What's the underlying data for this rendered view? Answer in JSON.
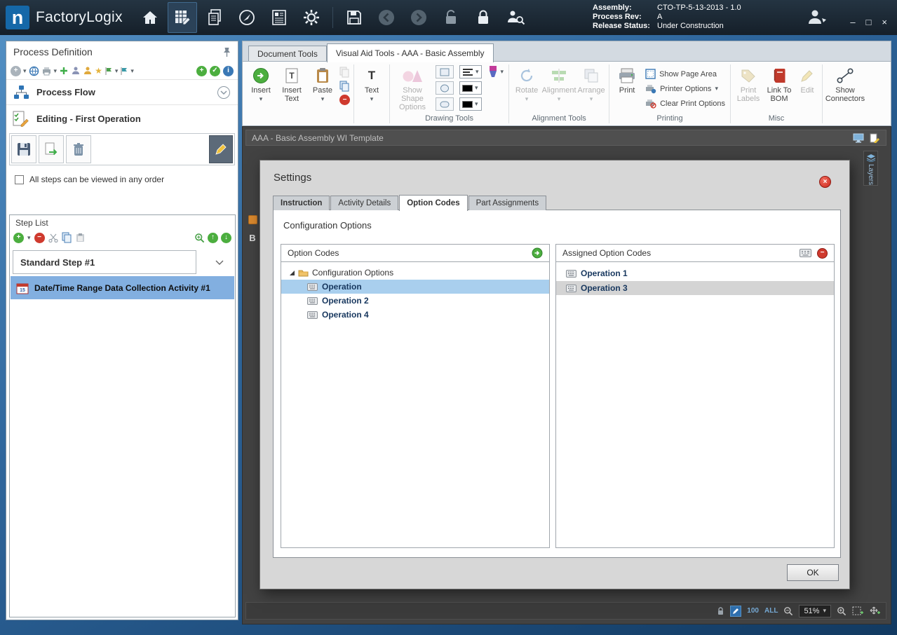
{
  "icons": {
    "dropdown": "▾",
    "plus": "+",
    "minus": "−",
    "check": "✓",
    "info": "i",
    "up_arrow": "↑",
    "down_arrow": "↓",
    "star": "★",
    "minimize": "–",
    "maximize": "□",
    "close": "×",
    "bold": "B",
    "text_tool": "T"
  },
  "colors": {
    "titlebar_bg": "#1a2732",
    "accent_blue": "#2f6fae",
    "tree_selection": "#a9cfee",
    "step_selection": "#82afe0",
    "doc_area_bg": "#424242",
    "dialog_bg": "#d7d7d7",
    "close_red": "#cd2a1e",
    "add_green": "#4cae3f",
    "remove_red": "#cf3a2e"
  },
  "titlebar": {
    "app_name": "FactoryLogix",
    "assembly_label": "Assembly:",
    "assembly_value": "CTO-TP-5-13-2013 - 1.0",
    "process_rev_label": "Process Rev:",
    "process_rev_value": "A",
    "release_status_label": "Release Status:",
    "release_status_value": "Under Construction"
  },
  "left_panel": {
    "title": "Process Definition",
    "process_flow_label": "Process Flow",
    "editing_label": "Editing - First Operation",
    "order_checkbox_label": "All steps can be viewed in any order",
    "step_list": {
      "title": "Step List",
      "group_header": "Standard Step #1",
      "selected_activity": "Date/Time Range Data Collection Activity #1"
    }
  },
  "main": {
    "doc_tabs": [
      {
        "label": "Document Tools"
      },
      {
        "label": "Visual Aid Tools - AAA - Basic Assembly"
      }
    ],
    "ribbon": {
      "insert": "Insert",
      "insert_text": "Insert Text",
      "paste": "Paste",
      "text": "Text",
      "show_shape_options": "Show Shape Options",
      "drawing_tools_group": "Drawing Tools",
      "rotate": "Rotate",
      "alignment": "Alignment",
      "arrange": "Arrange",
      "alignment_tools_group": "Alignment Tools",
      "print": "Print",
      "show_page_area": "Show Page Area",
      "printer_options": "Printer Options",
      "clear_print_options": "Clear Print Options",
      "printing_group": "Printing",
      "print_labels": "Print Labels",
      "link_to_bom": "Link To BOM",
      "edit": "Edit",
      "misc_group": "Misc",
      "show_connectors": "Show Connectors"
    },
    "document_title": "AAA - Basic Assembly WI Template",
    "layers_tab": "Layers",
    "statusbar": {
      "preset_100": "100",
      "preset_all": "ALL",
      "zoom": "51%"
    }
  },
  "dialog": {
    "title": "Settings",
    "tabs": [
      {
        "label": "Instruction"
      },
      {
        "label": "Activity Details"
      },
      {
        "label": "Option Codes"
      },
      {
        "label": "Part Assignments"
      }
    ],
    "active_tab": "Option Codes",
    "heading": "Configuration Options",
    "option_codes_panel": {
      "header": "Option Codes",
      "root_node": "Configuration Options",
      "items": [
        {
          "label": "Operation",
          "selected": true
        },
        {
          "label": "Operation 2",
          "selected": false
        },
        {
          "label": "Operation 4",
          "selected": false
        }
      ]
    },
    "assigned_panel": {
      "header": "Assigned Option Codes",
      "items": [
        {
          "label": "Operation 1",
          "selected": false
        },
        {
          "label": "Operation 3",
          "selected": true
        }
      ]
    },
    "ok_label": "OK"
  }
}
